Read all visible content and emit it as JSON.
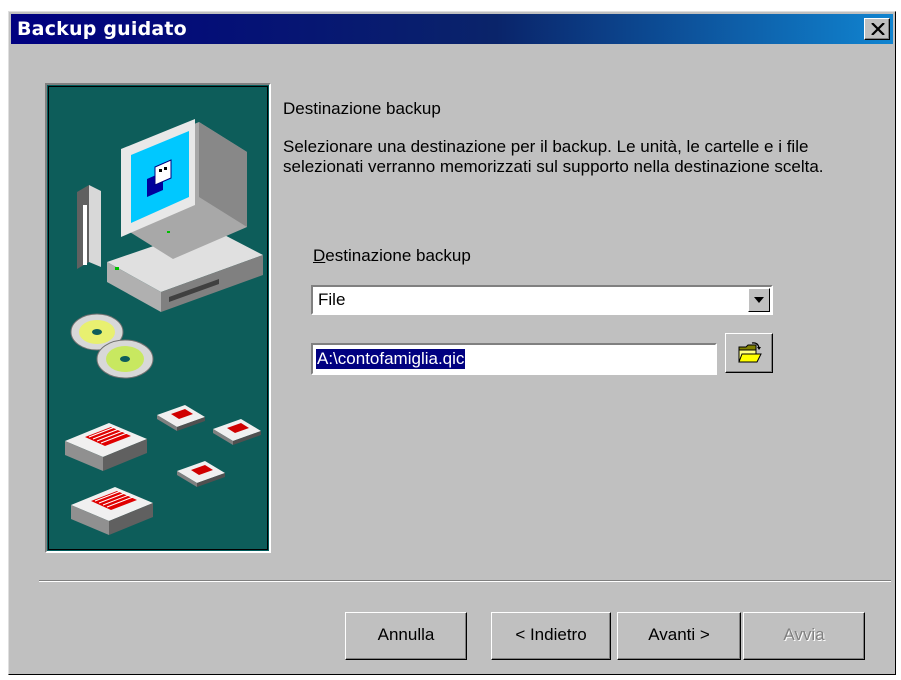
{
  "window": {
    "title": "Backup guidato"
  },
  "page": {
    "heading": "Destinazione backup",
    "description": "Selezionare una destinazione per il backup. Le unità, le cartelle e i file selezionati verranno memorizzati sul supporto nella destinazione scelta.",
    "field_label_prefix": "D",
    "field_label_rest": "estinazione backup",
    "destination_type": "File",
    "destination_path": "A:\\contofamiglia.qic"
  },
  "buttons": {
    "cancel": "Annulla",
    "back": "< Indietro",
    "next": "Avanti >",
    "start": "Avvia",
    "start_enabled": false
  },
  "icons": {
    "close": "close-icon",
    "dropdown": "chevron-down-icon",
    "browse": "open-folder-icon",
    "illustration": "computer-backup-illustration"
  },
  "colors": {
    "titlebar_start": "#000080",
    "titlebar_end": "#1084d0",
    "dialog_face": "#c0c0c0",
    "illustration_bg": "#0d5d5a",
    "selection": "#000080"
  }
}
